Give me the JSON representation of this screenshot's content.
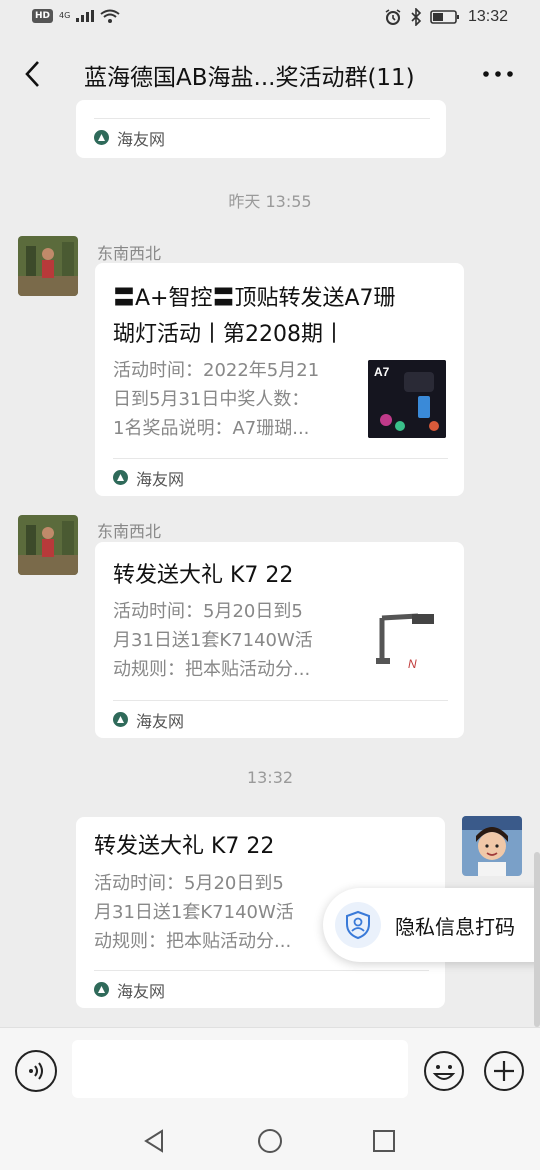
{
  "status_bar": {
    "badge": "HD",
    "network": "4G",
    "time": "13:32"
  },
  "header": {
    "title": "蓝海德国AB海盐...奖活动群(11)",
    "back_icon": "chevron-left-icon",
    "more_icon": "more-dots-icon"
  },
  "messages": [
    {
      "type": "card-partial",
      "source": "海友网"
    },
    {
      "type": "timestamp",
      "text": "昨天 13:55"
    },
    {
      "type": "card",
      "sender": "东南西北",
      "title_line1": "〓A+智控〓顶贴转发送A7珊",
      "title_line2": "瑚灯活动丨第2208期丨",
      "desc_line1": "活动时间：2022年5月21",
      "desc_line2": "日到5月31日中奖人数：",
      "desc_line3": "1名奖品说明：A7珊瑚...",
      "thumb_text": "A7",
      "source": "海友网"
    },
    {
      "type": "card",
      "sender": "东南西北",
      "title_line1": "转发送大礼 K7 22",
      "desc_line1": "活动时间：5月20日到5",
      "desc_line2": "月31日送1套K7140W活",
      "desc_line3": "动规则：把本贴活动分...",
      "thumb_text": "N",
      "source": "海友网"
    },
    {
      "type": "timestamp",
      "text": "13:32"
    },
    {
      "type": "card-self",
      "title_line1": "转发送大礼 K7 22",
      "desc_line1": "活动时间：5月20日到5",
      "desc_line2": "月31日送1套K7140W活",
      "desc_line3": "动规则：把本贴活动分...",
      "source": "海友网"
    }
  ],
  "privacy_popup": {
    "label": "隐私信息打码"
  },
  "input_bar": {
    "placeholder": ""
  },
  "colors": {
    "background": "#ededed",
    "card": "#ffffff",
    "source_icon": "#2f6a5a"
  }
}
